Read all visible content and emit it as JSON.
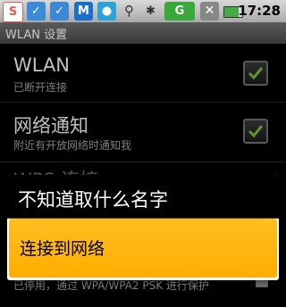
{
  "status_bar": {
    "time": "17:28",
    "icons": [
      "sougou-s-icon",
      "bird-icon",
      "bird-icon",
      "shield-m-icon",
      "chat-bubble-icon",
      "usb-icon",
      "android-debug-icon",
      "wifi-signal-icon",
      "no-signal-icon",
      "battery-icon"
    ],
    "signal_letter": "G"
  },
  "title_bar": {
    "title": "WLAN 设置"
  },
  "settings": [
    {
      "title": "WLAN",
      "subtitle": "已断开连接",
      "checked": true
    },
    {
      "title": "网络通知",
      "subtitle": "附近有开放网络时通知我",
      "checked": true
    },
    {
      "title": "WPS 连接",
      "subtitle": "已停用，通过 WPA/WPA2 PSK 进行保护"
    }
  ],
  "dialog": {
    "title": "不知道取什么名字",
    "item": "连接到网络"
  },
  "colors": {
    "accent": "#ffad00",
    "check_green": "#7ac943"
  }
}
